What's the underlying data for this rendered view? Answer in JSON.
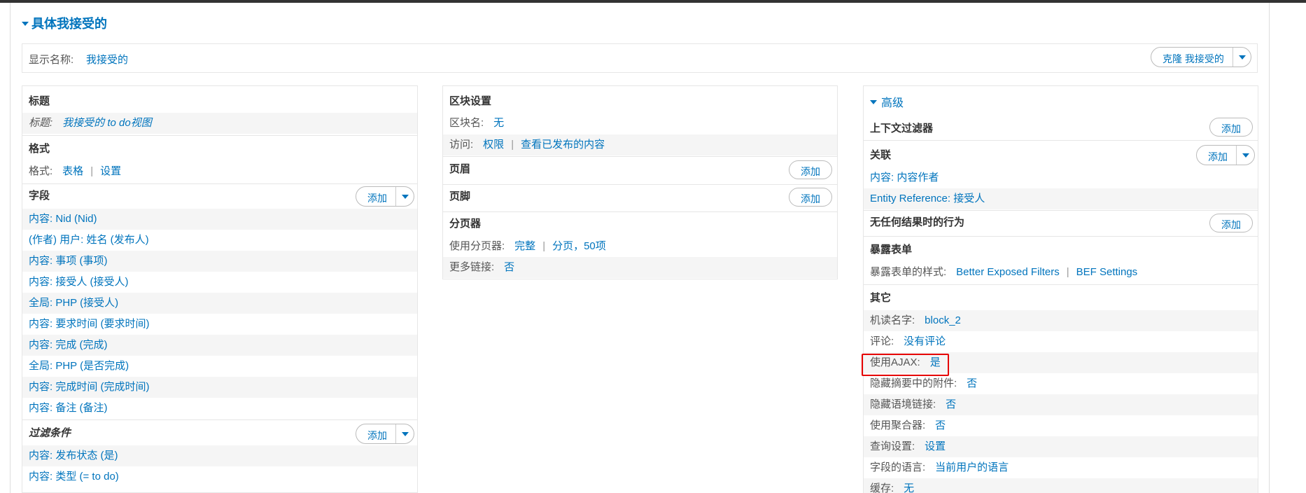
{
  "view": {
    "title": "具体我接受的",
    "display_name_label": "显示名称:",
    "display_name_value": "我接受的",
    "clone_button": "克隆 我接受的"
  },
  "left": {
    "title_section": "标题",
    "title_key": "标题:",
    "title_value": "我接受的 to do视图",
    "format_section": "格式",
    "format_key": "格式:",
    "format_value": "表格",
    "format_settings": "设置",
    "fields_section": "字段",
    "fields_add": "添加",
    "fields": [
      "内容: Nid (Nid)",
      "(作者) 用户: 姓名 (发布人)",
      "内容: 事项 (事项)",
      "内容: 接受人 (接受人)",
      "全局: PHP (接受人)",
      "内容: 要求时间 (要求时间)",
      "内容: 完成 (完成)",
      "全局: PHP (是否完成)",
      "内容: 完成时间 (完成时间)",
      "内容: 备注 (备注)"
    ],
    "filters_section": "过滤条件",
    "filters_add": "添加",
    "filters": [
      "内容: 发布状态 (是)",
      "内容: 类型 (= to do)"
    ]
  },
  "middle": {
    "block_section": "区块设置",
    "block_name_key": "区块名:",
    "block_name_value": "无",
    "access_key": "访问:",
    "access_value": "权限",
    "access_value2": "查看已发布的内容",
    "header_section": "页眉",
    "header_add": "添加",
    "footer_section": "页脚",
    "footer_add": "添加",
    "pager_section": "分页器",
    "pager_key": "使用分页器:",
    "pager_value": "完整",
    "pager_value2": "分页，50项",
    "more_key": "更多链接:",
    "more_value": "否"
  },
  "right": {
    "advanced": "高级",
    "context_section": "上下文过滤器",
    "context_add": "添加",
    "relations_section": "关联",
    "relations_add": "添加",
    "relations": [
      "内容: 内容作者",
      "Entity Reference: 接受人"
    ],
    "noresult_section": "无任何结果时的行为",
    "noresult_add": "添加",
    "exposed_section": "暴露表单",
    "exposed_key": "暴露表单的样式:",
    "exposed_value": "Better Exposed Filters",
    "exposed_value2": "BEF Settings",
    "other_section": "其它",
    "other": [
      {
        "k": "机读名字:",
        "v": "block_2"
      },
      {
        "k": "评论:",
        "v": "没有评论"
      },
      {
        "k": "使用AJAX:",
        "v": "是"
      },
      {
        "k": "隐藏摘要中的附件:",
        "v": "否"
      },
      {
        "k": "隐藏语境链接:",
        "v": "否"
      },
      {
        "k": "使用聚合器:",
        "v": "否"
      },
      {
        "k": "查询设置:",
        "v": "设置"
      },
      {
        "k": "字段的语言:",
        "v": "当前用户的语言"
      },
      {
        "k": "缓存:",
        "v": "无"
      }
    ]
  },
  "colors": {
    "link": "#0074bd",
    "highlight": "#e60000"
  }
}
